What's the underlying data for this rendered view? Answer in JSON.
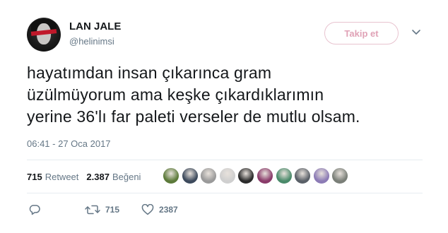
{
  "user": {
    "display_name": "LAN JALE",
    "handle": "@helinimsi"
  },
  "follow_button": {
    "label": "Takip et"
  },
  "tweet": {
    "lines": [
      "hayatımdan insan çıkarınca gram",
      "üzülmüyorum ama keşke çıkardıklarımın",
      "yerine 36'lı far paleti verseler de mutlu olsam."
    ],
    "timestamp": "06:41 - 27 Oca 2017"
  },
  "stats": {
    "retweet_count": "715",
    "retweet_label": "Retweet",
    "like_count": "2.387",
    "like_label": "Beğeni"
  },
  "liker_avatars": [
    {
      "color": "#5c7a3a"
    },
    {
      "color": "#3d4a5c"
    },
    {
      "color": "#9a9a9a"
    },
    {
      "color": "#cfcfcf"
    },
    {
      "color": "#2b2b2b"
    },
    {
      "color": "#8a3b6a"
    },
    {
      "color": "#4a8a6a"
    },
    {
      "color": "#5a6068"
    },
    {
      "color": "#8c7bb5"
    },
    {
      "color": "#7a7f78"
    }
  ],
  "actions": {
    "reply_icon": "reply-icon",
    "retweet_icon": "retweet-icon",
    "retweet_count": "715",
    "like_icon": "heart-icon",
    "like_count": "2387"
  },
  "colors": {
    "follow_accent": "#e0a2b6",
    "muted": "#657786",
    "text": "#14171a"
  }
}
